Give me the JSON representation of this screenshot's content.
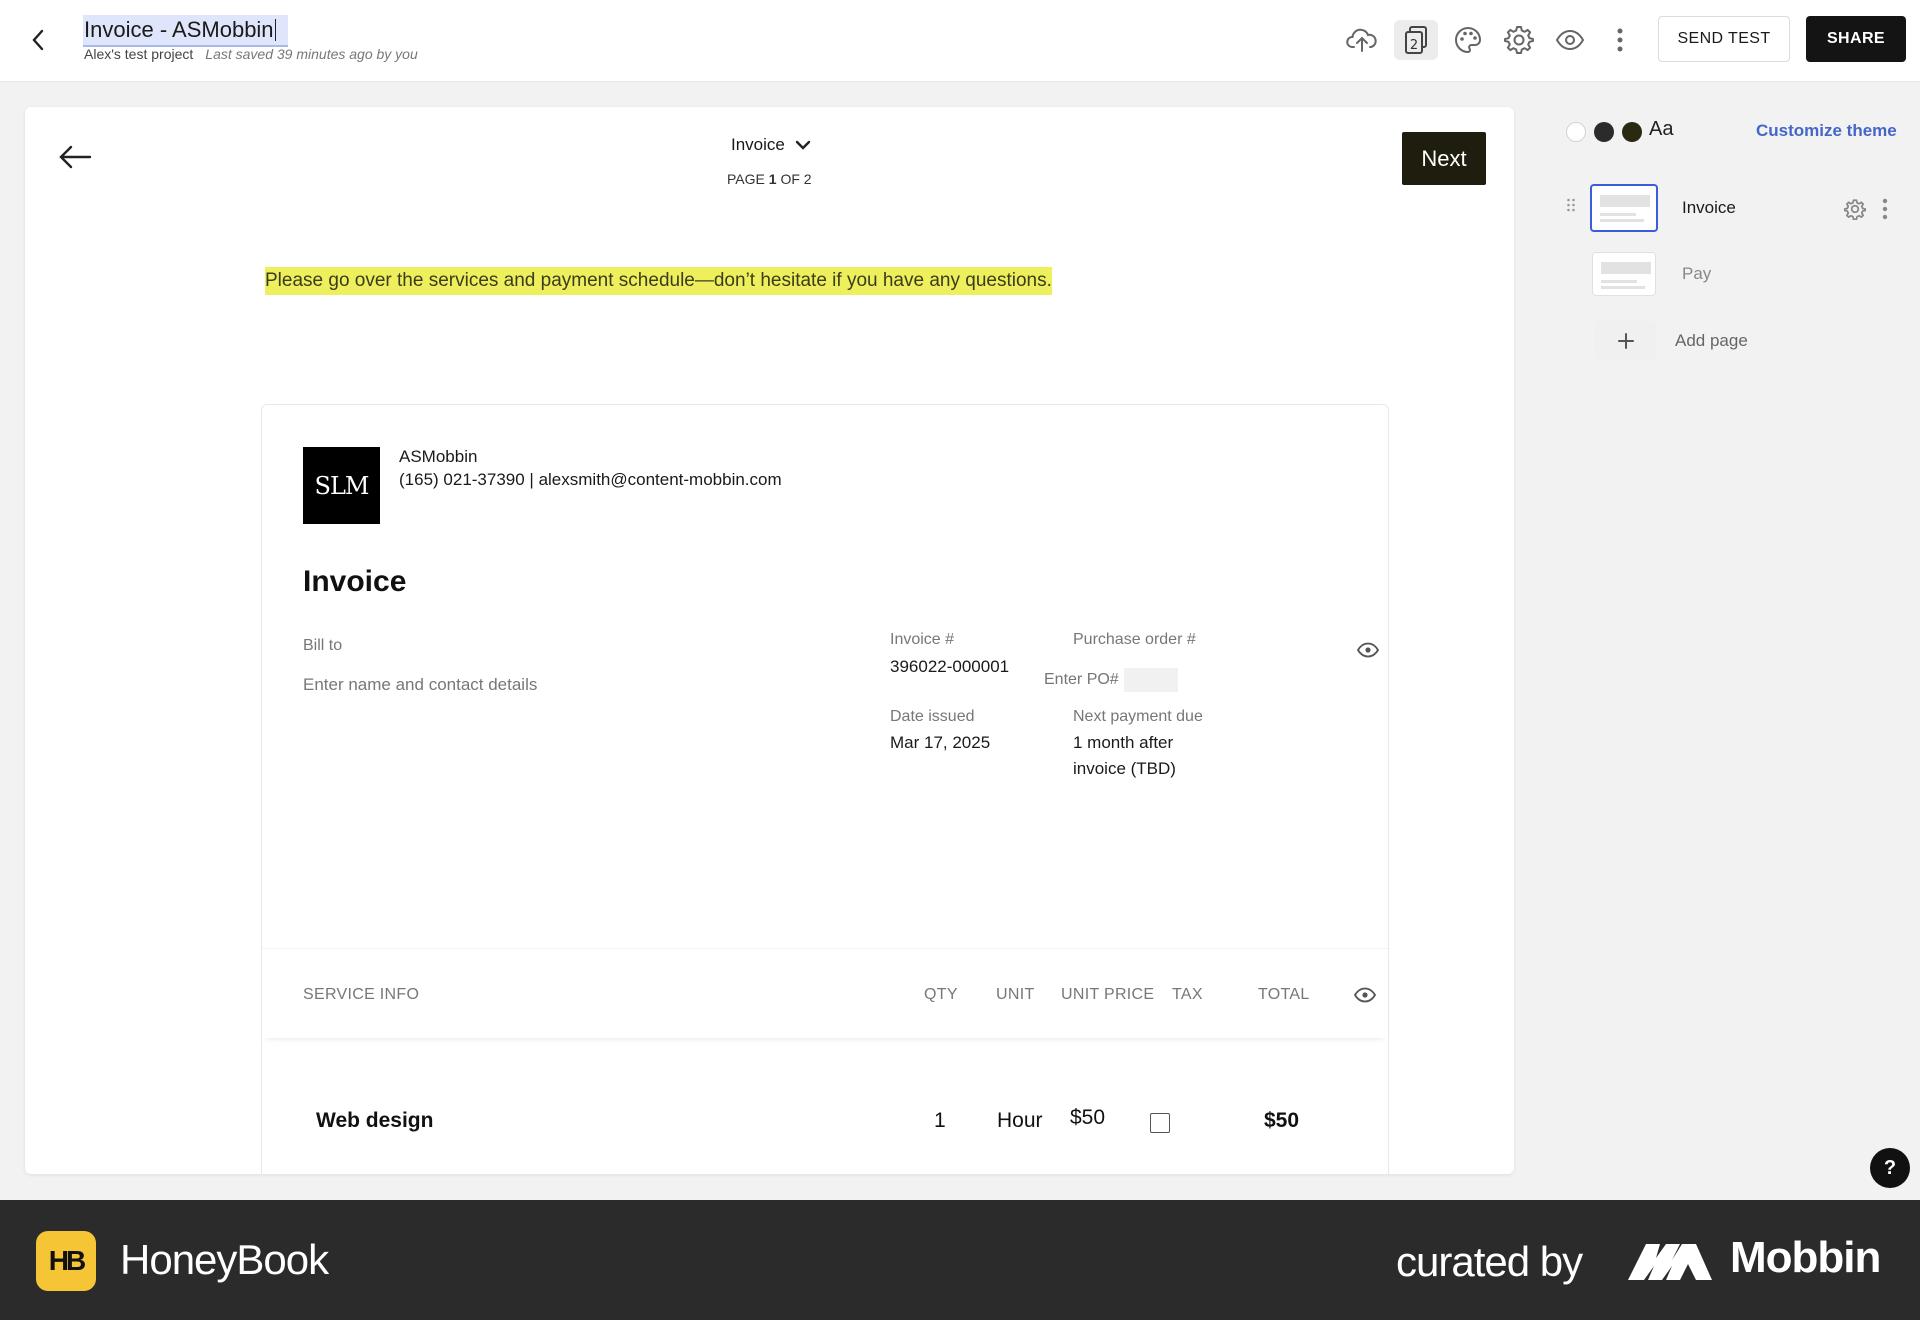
{
  "header": {
    "title": "Invoice - ASMobbin",
    "project": "Alex's test project",
    "last_saved": "Last saved 39 minutes ago by you",
    "pages_badge": "2",
    "send_test_label": "SEND TEST",
    "share_label": "SHARE",
    "icons": [
      "back-chevron-icon",
      "cloud-upload-icon",
      "pages-icon",
      "palette-icon",
      "gear-icon",
      "eye-icon",
      "more-vertical-icon"
    ]
  },
  "canvas": {
    "page_selector": "Invoice",
    "page_counter_prefix": "PAGE",
    "page_current": "1",
    "page_counter_suffix": "OF 2",
    "next_label": "Next",
    "message": "Please go over the services and payment schedule—don’t hesitate if you have any questions."
  },
  "invoice": {
    "logo_text": "SLM",
    "business_name": "ASMobbin",
    "business_contact": "(165) 021-37390 | alexsmith@content-mobbin.com",
    "heading": "Invoice",
    "bill_to_label": "Bill to",
    "bill_to_placeholder": "Enter name and contact details",
    "invoice_no_label": "Invoice #",
    "invoice_no": "396022-000001",
    "po_label": "Purchase order #",
    "po_placeholder": "Enter PO#",
    "date_issued_label": "Date issued",
    "date_issued": "Mar 17, 2025",
    "next_payment_label": "Next payment due",
    "next_payment_line1": "1 month after",
    "next_payment_line2": "invoice (TBD)",
    "columns": {
      "service": "SERVICE INFO",
      "qty": "QTY",
      "unit": "UNIT",
      "unit_price": "UNIT PRICE",
      "tax": "TAX",
      "total": "TOTAL"
    },
    "items": [
      {
        "service": "Web design",
        "qty": "1",
        "unit": "Hour",
        "unit_price": "$50",
        "tax": false,
        "total": "$50"
      }
    ]
  },
  "sidebar": {
    "theme_label": "Aa",
    "customize_label": "Customize theme",
    "theme_colors": [
      "#ffffff",
      "#2b2b2b",
      "#2a2a12"
    ],
    "pages": [
      {
        "label": "Invoice",
        "selected": true
      },
      {
        "label": "Pay",
        "selected": false
      }
    ],
    "add_page_label": "Add page"
  },
  "help_label": "?",
  "footer": {
    "brand": "HoneyBook",
    "brand_logo": "HB",
    "curated_by": "curated by",
    "curator": "Mobbin"
  },
  "colors": {
    "accent_blue": "#3d5bd9",
    "highlight_yellow": "#eeef5c",
    "next_button": "#1f1e0e",
    "honeybook_yellow": "#f5c536"
  }
}
